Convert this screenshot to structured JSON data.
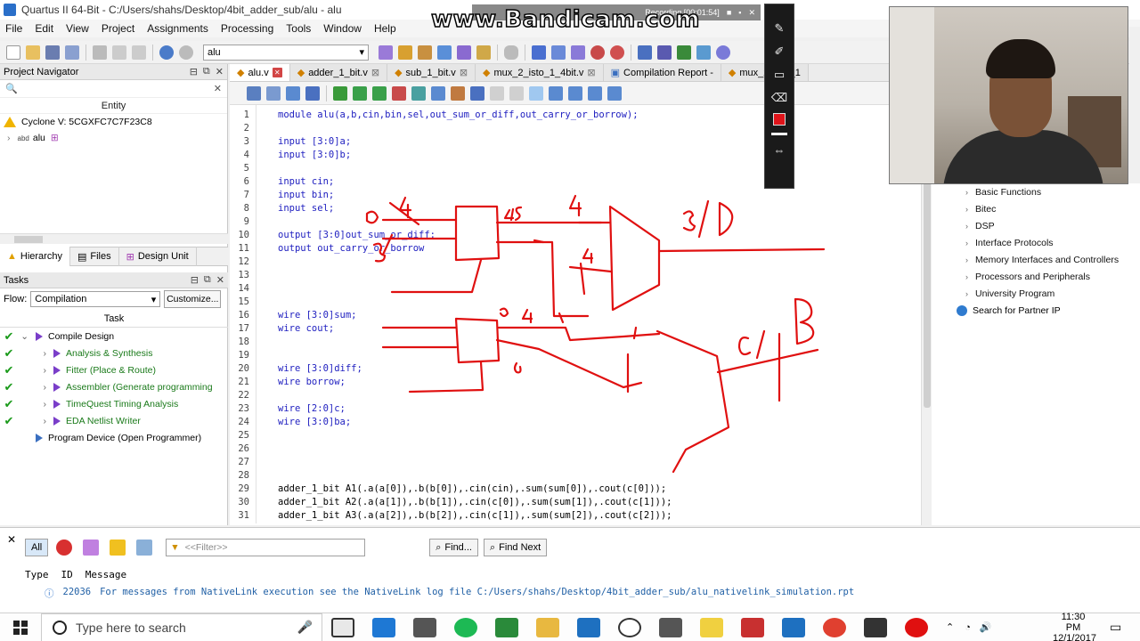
{
  "window": {
    "title": "Quartus II 64-Bit - C:/Users/shahs/Desktop/4bit_adder_sub/alu - alu"
  },
  "menu": [
    "File",
    "Edit",
    "View",
    "Project",
    "Assignments",
    "Processing",
    "Tools",
    "Window",
    "Help"
  ],
  "toolbar": {
    "entity_select": "alu"
  },
  "project_navigator": {
    "title": "Project Navigator",
    "column": "Entity",
    "device": "Cyclone V: 5CGXFC7C7F23C8",
    "top_entity": "alu",
    "tabs": [
      "Hierarchy",
      "Files",
      "Design Unit"
    ]
  },
  "tasks": {
    "title": "Tasks",
    "flow_label": "Flow:",
    "flow_value": "Compilation",
    "customize": "Customize...",
    "column": "Task",
    "items": [
      {
        "label": "Compile Design",
        "done": true,
        "level": 0
      },
      {
        "label": "Analysis & Synthesis",
        "done": true,
        "level": 1
      },
      {
        "label": "Fitter (Place & Route)",
        "done": true,
        "level": 1
      },
      {
        "label": "Assembler (Generate programming",
        "done": true,
        "level": 1
      },
      {
        "label": "TimeQuest Timing Analysis",
        "done": true,
        "level": 1
      },
      {
        "label": "EDA Netlist Writer",
        "done": true,
        "level": 1
      },
      {
        "label": "Program Device (Open Programmer)",
        "done": false,
        "level": 0
      }
    ]
  },
  "file_tabs": [
    "alu.v",
    "adder_1_bit.v",
    "sub_1_bit.v",
    "mux_2_isto_1_4bit.v",
    "Compilation Report -",
    "mux_2_isto_1"
  ],
  "code": [
    {
      "n": "1",
      "t": "module alu(a,b,cin,bin,sel,out_sum_or_diff,out_carry_or_borrow);"
    },
    {
      "n": "2",
      "t": ""
    },
    {
      "n": "3",
      "t": "input [3:0]a;"
    },
    {
      "n": "4",
      "t": "input [3:0]b;"
    },
    {
      "n": "5",
      "t": ""
    },
    {
      "n": "6",
      "t": "input cin;"
    },
    {
      "n": "7",
      "t": "input bin;"
    },
    {
      "n": "8",
      "t": "input sel;"
    },
    {
      "n": "9",
      "t": ""
    },
    {
      "n": "10",
      "t": "output [3:0]out_sum_or_diff;"
    },
    {
      "n": "11",
      "t": "output out_carry_or_borrow"
    },
    {
      "n": "12",
      "t": ""
    },
    {
      "n": "13",
      "t": ""
    },
    {
      "n": "14",
      "t": ""
    },
    {
      "n": "15",
      "t": ""
    },
    {
      "n": "16",
      "t": "wire [3:0]sum;"
    },
    {
      "n": "17",
      "t": "wire cout;"
    },
    {
      "n": "18",
      "t": ""
    },
    {
      "n": "19",
      "t": ""
    },
    {
      "n": "20",
      "t": "wire [3:0]diff;"
    },
    {
      "n": "21",
      "t": "wire borrow;"
    },
    {
      "n": "22",
      "t": ""
    },
    {
      "n": "23",
      "t": "wire [2:0]c;"
    },
    {
      "n": "24",
      "t": "wire [3:0]ba;"
    },
    {
      "n": "25",
      "t": ""
    },
    {
      "n": "26",
      "t": ""
    },
    {
      "n": "27",
      "t": ""
    },
    {
      "n": "28",
      "t": ""
    },
    {
      "n": "29",
      "t": "adder_1_bit A1(.a(a[0]),.b(b[0]),.cin(cin),.sum(sum[0]),.cout(c[0]));"
    },
    {
      "n": "30",
      "t": "adder_1_bit A2(.a(a[1]),.b(b[1]),.cin(c[0]),.sum(sum[1]),.cout(c[1]));"
    },
    {
      "n": "31",
      "t": "adder_1_bit A3(.a(a[2]),.b(b[2]),.cin(c[1]),.sum(sum[2]),.cout(c[2]));"
    }
  ],
  "ip_catalog": {
    "items": [
      "Basic Functions",
      "Bitec",
      "DSP",
      "Interface Protocols",
      "Memory Interfaces and Controllers",
      "Processors and Peripherals",
      "University Program"
    ],
    "search": "Search for Partner IP"
  },
  "messages": {
    "filter_placeholder": "<<Filter>>",
    "all": "All",
    "find": "Find...",
    "find_next": "Find Next",
    "columns": [
      "Type",
      "ID",
      "Message"
    ],
    "row": {
      "id": "22036",
      "text": "For messages from NativeLink execution see the NativeLink log file C:/Users/shahs/Desktop/4bit_adder_sub/alu_nativelink_simulation.rpt"
    }
  },
  "recording": {
    "watermark": "www.Bandicam.com",
    "status": "Recording [00:01:54]"
  },
  "taskbar": {
    "search_text": "Type here to search",
    "time": "11:30 PM",
    "date": "12/1/2017"
  },
  "annotations": [
    "4",
    "a",
    "45",
    "4",
    "S/D",
    "4",
    "b",
    "4",
    "C/B",
    "B",
    "B"
  ]
}
